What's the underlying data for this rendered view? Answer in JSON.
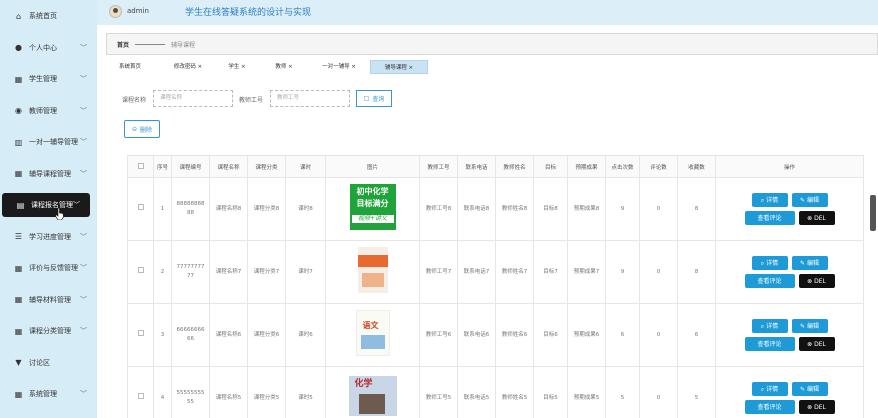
{
  "header": {
    "user": "admin",
    "system_title": "学生在线答疑系统的设计与实现"
  },
  "sidebar": {
    "items": [
      {
        "label": "系统首页",
        "icon": "home-icon",
        "chevron": false
      },
      {
        "label": "个人中心",
        "icon": "user-icon",
        "chevron": true
      },
      {
        "label": "学生管理",
        "icon": "grid-icon",
        "chevron": true
      },
      {
        "label": "教师管理",
        "icon": "pin-icon",
        "chevron": true
      },
      {
        "label": "一对一辅导管理",
        "icon": "chart-icon",
        "chevron": true
      },
      {
        "label": "辅导课程管理",
        "icon": "grid-icon",
        "chevron": true
      },
      {
        "label": "课程报名管理",
        "icon": "clipboard-icon",
        "chevron": true,
        "active": true
      },
      {
        "label": "学习进度管理",
        "icon": "list-icon",
        "chevron": true
      },
      {
        "label": "评价与反馈管理",
        "icon": "grid-icon",
        "chevron": true
      },
      {
        "label": "辅导材料管理",
        "icon": "grid-icon",
        "chevron": true
      },
      {
        "label": "课程分类管理",
        "icon": "grid-icon",
        "chevron": true
      },
      {
        "label": "讨论区",
        "icon": "shield-icon",
        "chevron": false
      },
      {
        "label": "系统管理",
        "icon": "grid-icon",
        "chevron": true
      }
    ]
  },
  "breadcrumb": {
    "home": "首页",
    "current": "辅导课程"
  },
  "tabs": [
    "系统首页",
    "修改密码 ×",
    "学生 ×",
    "教师 ×",
    "一对一辅导 ×",
    "辅导课程 ×"
  ],
  "search": {
    "course_name_label": "课程名称",
    "course_name_placeholder": "课程名称",
    "teacher_id_label": "教师工号",
    "teacher_id_placeholder": "教师工号",
    "query_label": "查询",
    "delete_label": "删除"
  },
  "table": {
    "headers": [
      "",
      "序号",
      "课程编号",
      "课程名称",
      "课程分类",
      "课时",
      "图片",
      "教师工号",
      "联系电话",
      "教师姓名",
      "目标",
      "预期成果",
      "点击次数",
      "评论数",
      "收藏数",
      "操作"
    ],
    "rows": [
      {
        "no": "1",
        "code": "8888888888",
        "name": "课程名称8",
        "category": "课程分类8",
        "hours": "课时8",
        "image": "green",
        "image_texts": [
          "初中化学",
          "目标满分",
          "视频+讲义"
        ],
        "teacher_id": "教师工号8",
        "phone": "联系电话8",
        "teacher": "教师姓名8",
        "goal": "目标8",
        "outcome": "预期成果8",
        "clicks": "9",
        "comments": "0",
        "favorites": "8"
      },
      {
        "no": "2",
        "code": "7777777777",
        "name": "课程名称7",
        "category": "课程分类7",
        "hours": "课时7",
        "image": "book1",
        "image_texts": [],
        "teacher_id": "教师工号7",
        "phone": "联系电话7",
        "teacher": "教师姓名7",
        "goal": "目标7",
        "outcome": "预期成果7",
        "clicks": "9",
        "comments": "0",
        "favorites": "8"
      },
      {
        "no": "3",
        "code": "6666666666",
        "name": "课程名称6",
        "category": "课程分类6",
        "hours": "课时6",
        "image": "book2",
        "image_texts": [
          "语文"
        ],
        "teacher_id": "教师工号6",
        "phone": "联系电话6",
        "teacher": "教师姓名6",
        "goal": "目标6",
        "outcome": "预期成果6",
        "clicks": "6",
        "comments": "0",
        "favorites": "6"
      },
      {
        "no": "4",
        "code": "5555555555",
        "name": "课程名称5",
        "category": "课程分类5",
        "hours": "课时5",
        "image": "book3",
        "image_texts": [
          "化学"
        ],
        "teacher_id": "教师工号5",
        "phone": "联系电话5",
        "teacher": "教师姓名5",
        "goal": "目标5",
        "outcome": "预期成果5",
        "clicks": "5",
        "comments": "0",
        "favorites": "5"
      }
    ],
    "actions": {
      "detail": "详情",
      "edit": "编辑",
      "reviews": "查看评论",
      "del": "DEL"
    }
  },
  "colors": {
    "sidebar_bg": "#d6ecf7",
    "header_bg": "#dceef8",
    "primary": "#1e9bd6",
    "title": "#2a7fc0",
    "active": "#1a1a1a"
  }
}
